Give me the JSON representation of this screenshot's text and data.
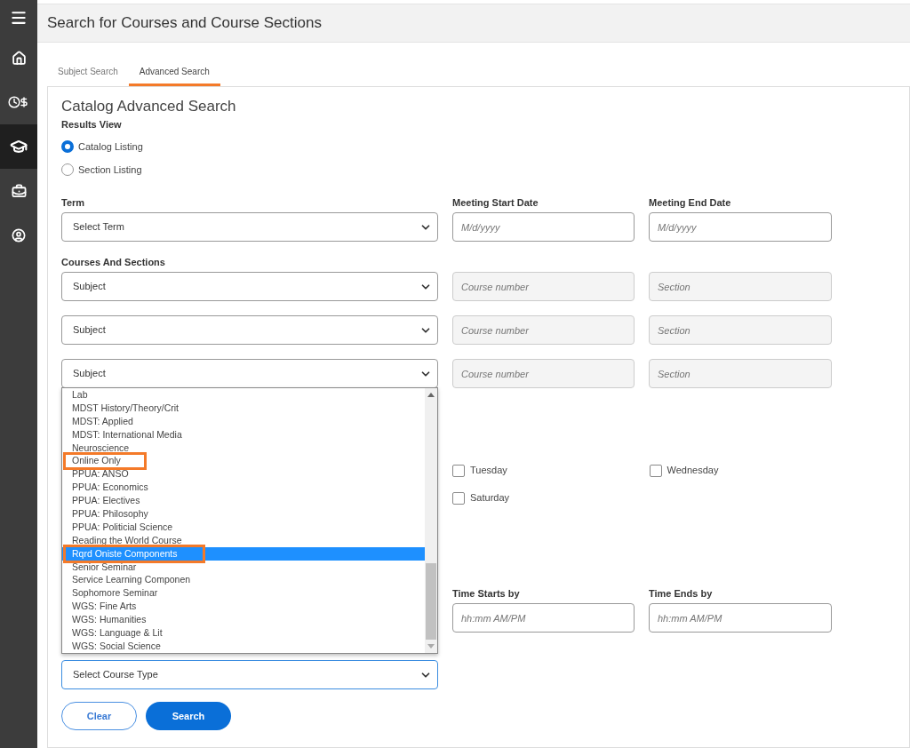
{
  "sidebar": {
    "items": [
      {
        "kind": "menu",
        "selected": false
      },
      {
        "kind": "home",
        "selected": false
      },
      {
        "kind": "finance",
        "selected": false
      },
      {
        "kind": "academics",
        "selected": true
      },
      {
        "kind": "briefcase",
        "selected": false
      },
      {
        "kind": "profile",
        "selected": false
      }
    ]
  },
  "header": {
    "title": "Search for Courses and Course Sections"
  },
  "tabs": [
    {
      "label": "Subject Search",
      "selected": false
    },
    {
      "label": "Advanced Search",
      "selected": true
    }
  ],
  "form": {
    "heading": "Catalog Advanced Search",
    "results_view": {
      "label": "Results View",
      "options": [
        {
          "label": "Catalog Listing",
          "selected": true
        },
        {
          "label": "Section Listing",
          "selected": false
        }
      ]
    },
    "term": {
      "label": "Term",
      "value": "Select Term"
    },
    "meeting_start": {
      "label": "Meeting Start Date",
      "placeholder": "M/d/yyyy"
    },
    "meeting_end": {
      "label": "Meeting End Date",
      "placeholder": "M/d/yyyy"
    },
    "courses_label": "Courses And Sections",
    "course_rows": [
      {
        "subject": "Subject",
        "course_placeholder": "Course number",
        "section_placeholder": "Section"
      },
      {
        "subject": "Subject",
        "course_placeholder": "Course number",
        "section_placeholder": "Section"
      },
      {
        "subject": "Subject",
        "course_placeholder": "Course number",
        "section_placeholder": "Section"
      }
    ],
    "dropdown": {
      "items": [
        {
          "label": "Lab",
          "selected": false,
          "annotated": false
        },
        {
          "label": "MDST History/Theory/Crit",
          "selected": false,
          "annotated": false
        },
        {
          "label": "MDST: Applied",
          "selected": false,
          "annotated": false
        },
        {
          "label": "MDST: International Media",
          "selected": false,
          "annotated": false
        },
        {
          "label": "Neuroscience",
          "selected": false,
          "annotated": false
        },
        {
          "label": "Online Only",
          "selected": false,
          "annotated": true
        },
        {
          "label": "PPUA: ANSO",
          "selected": false,
          "annotated": false
        },
        {
          "label": "PPUA: Economics",
          "selected": false,
          "annotated": false
        },
        {
          "label": "PPUA: Electives",
          "selected": false,
          "annotated": false
        },
        {
          "label": "PPUA: Philosophy",
          "selected": false,
          "annotated": false
        },
        {
          "label": "PPUA: Politicial Science",
          "selected": false,
          "annotated": false
        },
        {
          "label": "Reading the World Course",
          "selected": false,
          "annotated": false
        },
        {
          "label": "Rqrd Oniste Components",
          "selected": true,
          "annotated": true
        },
        {
          "label": "Senior Seminar",
          "selected": false,
          "annotated": false
        },
        {
          "label": "Service Learning Componen",
          "selected": false,
          "annotated": false
        },
        {
          "label": "Sophomore Seminar",
          "selected": false,
          "annotated": false
        },
        {
          "label": "WGS: Fine Arts",
          "selected": false,
          "annotated": false
        },
        {
          "label": "WGS: Humanities",
          "selected": false,
          "annotated": false
        },
        {
          "label": "WGS: Language & Lit",
          "selected": false,
          "annotated": false
        },
        {
          "label": "WGS: Social Science",
          "selected": false,
          "annotated": false
        }
      ]
    },
    "weekdays": [
      {
        "label": "Tuesday",
        "checked": false
      },
      {
        "label": "Wednesday",
        "checked": false
      },
      {
        "label": "Saturday",
        "checked": false
      }
    ],
    "time_start": {
      "label": "Time Starts by",
      "placeholder": "hh:mm AM/PM"
    },
    "time_end": {
      "label": "Time Ends by",
      "placeholder": "hh:mm AM/PM"
    },
    "course_type": {
      "value": "Select Course Type"
    },
    "buttons": [
      {
        "label": "Clear",
        "kind": "secondary"
      },
      {
        "label": "Search",
        "kind": "primary"
      }
    ]
  }
}
